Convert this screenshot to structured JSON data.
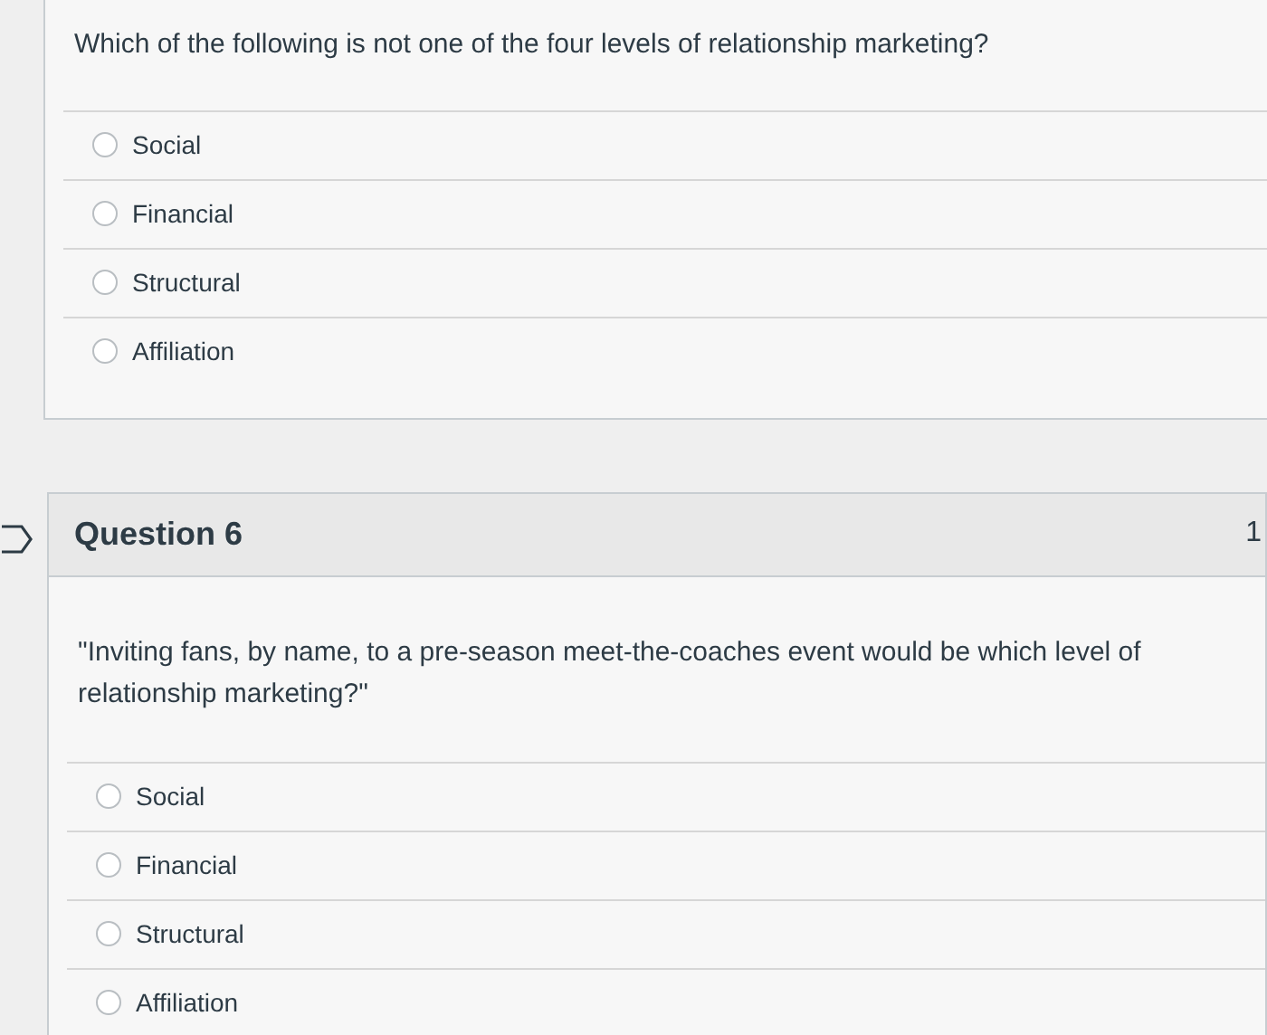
{
  "previous_question": {
    "prompt": "Which of the following is not one of the four levels of relationship marketing?",
    "options": [
      {
        "label": "Social",
        "selected": false
      },
      {
        "label": "Financial",
        "selected": false
      },
      {
        "label": "Structural",
        "selected": false
      },
      {
        "label": "Affiliation",
        "selected": false
      }
    ]
  },
  "question": {
    "title": "Question 6",
    "points": "1",
    "prompt": "\"Inviting fans, by name, to a pre-season meet-the-coaches event would be which level of relationship marketing?\"",
    "options": [
      {
        "label": "Social",
        "selected": false
      },
      {
        "label": "Financial",
        "selected": false
      },
      {
        "label": "Structural",
        "selected": false
      },
      {
        "label": "Affiliation",
        "selected": false
      }
    ]
  }
}
